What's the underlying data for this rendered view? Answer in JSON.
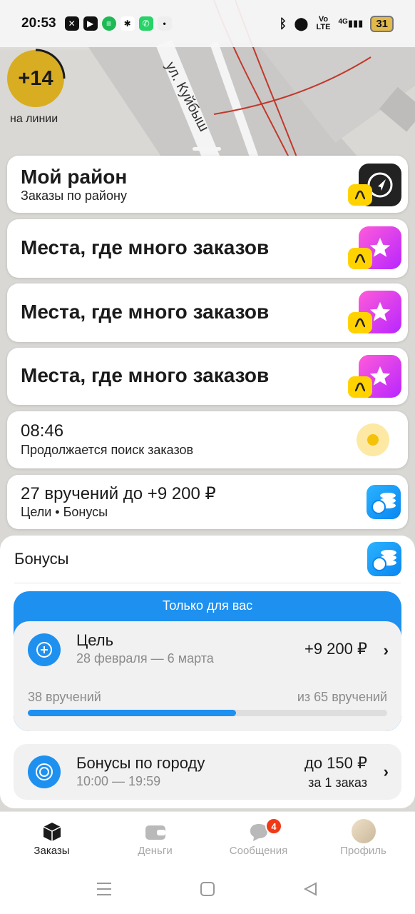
{
  "status_bar": {
    "time": "20:53",
    "network_label": "Vo LTE",
    "signal_label": "4G",
    "battery": "31"
  },
  "map": {
    "street_label": "ул. Куйбыш",
    "background_color": "#dcdbd8"
  },
  "online": {
    "count": "+14",
    "label": "на линии"
  },
  "cards": {
    "my_district": {
      "title": "Мой район",
      "subtitle": "Заказы по району",
      "icon": "navigation-arrow-icon"
    },
    "hot_places": [
      {
        "title": "Места, где много заказов",
        "icon": "star-icon"
      },
      {
        "title": "Места, где много заказов",
        "icon": "star-icon"
      },
      {
        "title": "Места, где много заказов",
        "icon": "star-icon"
      }
    ],
    "search": {
      "time": "08:46",
      "status": "Продолжается поиск заказов"
    },
    "deliveries": {
      "title": "27 вручений до +9 200 ₽",
      "subtitle": "Цели • Бонусы",
      "icon": "coins-icon"
    }
  },
  "bonuses": {
    "title": "Бонусы",
    "goal": {
      "header": "Только для вас",
      "name": "Цель",
      "dates": "28 февраля — 6 марта",
      "amount": "+9 200 ₽",
      "progress_left": "38 вручений",
      "progress_right": "из 65 вручений",
      "progress_fraction": 0.58
    },
    "city": {
      "name": "Бонусы по городу",
      "time": "10:00 — 19:59",
      "amount": "до 150 ₽",
      "per": "за 1 заказ"
    }
  },
  "bottom_nav": {
    "items": [
      {
        "label": "Заказы",
        "icon": "box-icon",
        "active": true
      },
      {
        "label": "Деньги",
        "icon": "wallet-icon",
        "active": false
      },
      {
        "label": "Сообщения",
        "icon": "chat-icon",
        "active": false,
        "badge": "4"
      },
      {
        "label": "Профиль",
        "icon": "avatar",
        "active": false
      }
    ]
  },
  "colors": {
    "accent_blue": "#1e90f0",
    "yellow": "#ffd200",
    "pink": "#d63dfc",
    "badge_red": "#f03a17"
  }
}
